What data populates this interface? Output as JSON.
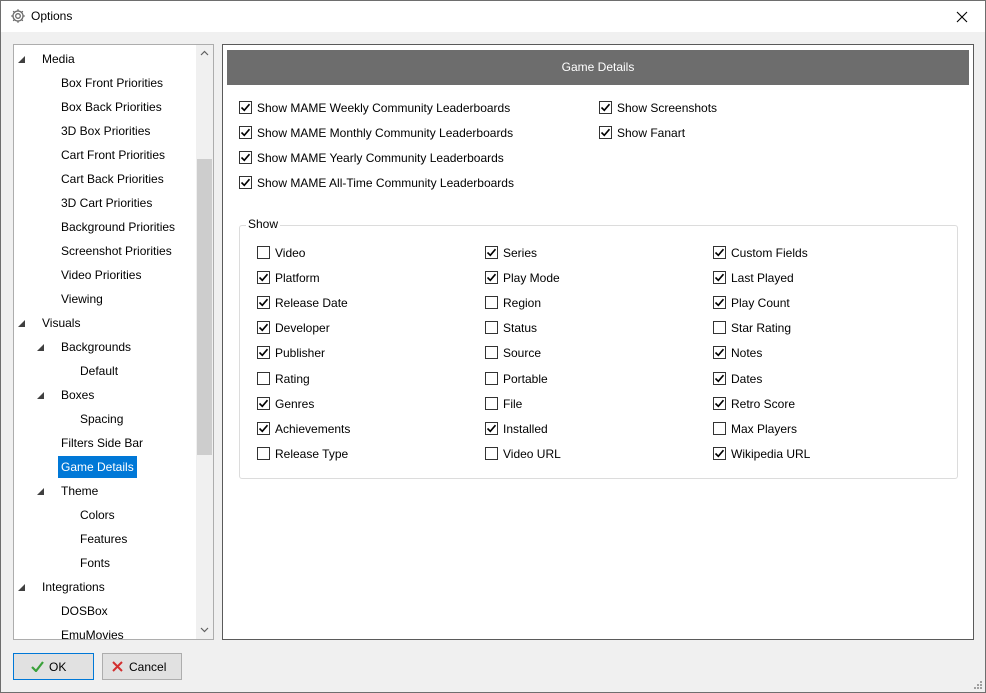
{
  "window": {
    "title": "Options"
  },
  "tree": {
    "items": [
      {
        "label": "Media",
        "depth": 0,
        "expander": true
      },
      {
        "label": "Box Front Priorities",
        "depth": 1
      },
      {
        "label": "Box Back Priorities",
        "depth": 1
      },
      {
        "label": "3D Box Priorities",
        "depth": 1
      },
      {
        "label": "Cart Front Priorities",
        "depth": 1
      },
      {
        "label": "Cart Back Priorities",
        "depth": 1
      },
      {
        "label": "3D Cart Priorities",
        "depth": 1
      },
      {
        "label": "Background Priorities",
        "depth": 1
      },
      {
        "label": "Screenshot Priorities",
        "depth": 1
      },
      {
        "label": "Video Priorities",
        "depth": 1
      },
      {
        "label": "Viewing",
        "depth": 1
      },
      {
        "label": "Visuals",
        "depth": 0,
        "expander": true
      },
      {
        "label": "Backgrounds",
        "depth": 1,
        "expander": true
      },
      {
        "label": "Default",
        "depth": 2
      },
      {
        "label": "Boxes",
        "depth": 1,
        "expander": true
      },
      {
        "label": "Spacing",
        "depth": 2
      },
      {
        "label": "Filters Side Bar",
        "depth": 1
      },
      {
        "label": "Game Details",
        "depth": 1,
        "selected": true
      },
      {
        "label": "Theme",
        "depth": 1,
        "expander": true
      },
      {
        "label": "Colors",
        "depth": 2
      },
      {
        "label": "Features",
        "depth": 2
      },
      {
        "label": "Fonts",
        "depth": 2
      },
      {
        "label": "Integrations",
        "depth": 0,
        "expander": true
      },
      {
        "label": "DOSBox",
        "depth": 1
      },
      {
        "label": "EmuMovies",
        "depth": 1
      }
    ]
  },
  "panel": {
    "header": "Game Details",
    "top_options": [
      {
        "label": "Show MAME Weekly Community Leaderboards",
        "checked": true
      },
      {
        "label": "Show MAME Monthly Community Leaderboards",
        "checked": true
      },
      {
        "label": "Show MAME Yearly Community Leaderboards",
        "checked": true
      },
      {
        "label": "Show MAME All-Time Community Leaderboards",
        "checked": true
      }
    ],
    "right_options": [
      {
        "label": "Show Screenshots",
        "checked": true
      },
      {
        "label": "Show Fanart",
        "checked": true
      }
    ],
    "show_group": {
      "title": "Show",
      "columns": [
        [
          {
            "label": "Video",
            "checked": false
          },
          {
            "label": "Platform",
            "checked": true
          },
          {
            "label": "Release Date",
            "checked": true
          },
          {
            "label": "Developer",
            "checked": true
          },
          {
            "label": "Publisher",
            "checked": true
          },
          {
            "label": "Rating",
            "checked": false
          },
          {
            "label": "Genres",
            "checked": true
          },
          {
            "label": "Achievements",
            "checked": true
          },
          {
            "label": "Release Type",
            "checked": false
          }
        ],
        [
          {
            "label": "Series",
            "checked": true
          },
          {
            "label": "Play Mode",
            "checked": true
          },
          {
            "label": "Region",
            "checked": false
          },
          {
            "label": "Status",
            "checked": false
          },
          {
            "label": "Source",
            "checked": false
          },
          {
            "label": "Portable",
            "checked": false
          },
          {
            "label": "File",
            "checked": false
          },
          {
            "label": "Installed",
            "checked": true
          },
          {
            "label": "Video URL",
            "checked": false
          }
        ],
        [
          {
            "label": "Custom Fields",
            "checked": true
          },
          {
            "label": "Last Played",
            "checked": true
          },
          {
            "label": "Play Count",
            "checked": true
          },
          {
            "label": "Star Rating",
            "checked": false
          },
          {
            "label": "Notes",
            "checked": true
          },
          {
            "label": "Dates",
            "checked": true
          },
          {
            "label": "Retro Score",
            "checked": true
          },
          {
            "label": "Max Players",
            "checked": false
          },
          {
            "label": "Wikipedia URL",
            "checked": true
          }
        ]
      ]
    }
  },
  "footer": {
    "ok_label": "OK",
    "cancel_label": "Cancel"
  },
  "colors": {
    "selection": "#0078d7",
    "header_bg": "#6d6d6d",
    "ok_icon": "#3aa13a",
    "cancel_icon": "#d32f2f"
  },
  "icons": {
    "app": "gear-icon",
    "close": "close-icon",
    "ok": "checkmark-icon",
    "cancel": "x-icon"
  }
}
